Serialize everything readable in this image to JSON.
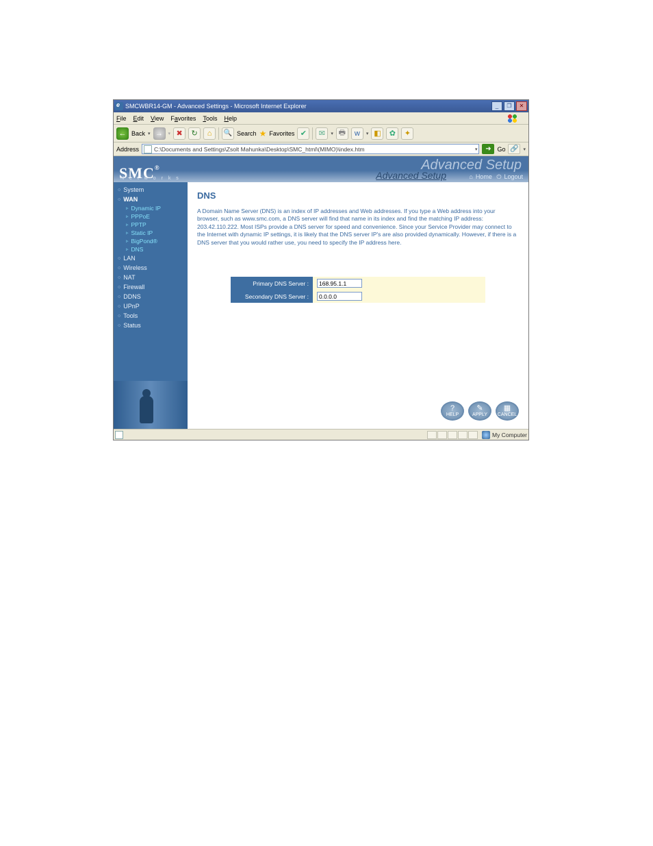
{
  "window": {
    "title": "SMCWBR14-GM - Advanced Settings - Microsoft Internet Explorer"
  },
  "menubar": [
    "File",
    "Edit",
    "View",
    "Favorites",
    "Tools",
    "Help"
  ],
  "toolbar": {
    "back": "Back",
    "search": "Search",
    "favorites": "Favorites"
  },
  "addressbar": {
    "label": "Address",
    "value": "C:\\Documents and Settings\\Zsolt Mahunka\\Desktop\\SMC_html\\(MIMO)\\index.htm",
    "go": "Go"
  },
  "brand": {
    "logo": "SMC",
    "networks": "N e t w o r k s",
    "advanced_big": "Advanced Setup",
    "setup": "Advanced Setup",
    "home": "Home",
    "logout": "Logout"
  },
  "sidebar": {
    "system": "System",
    "wan": "WAN",
    "wan_subs": [
      "Dynamic IP",
      "PPPoE",
      "PPTP",
      "Static IP",
      "BigPond®",
      "DNS"
    ],
    "lan": "LAN",
    "wireless": "Wireless",
    "nat": "NAT",
    "firewall": "Firewall",
    "ddns": "DDNS",
    "upnp": "UPnP",
    "tools": "Tools",
    "status": "Status"
  },
  "content": {
    "heading": "DNS",
    "desc": "A Domain Name Server (DNS) is an index of IP addresses and Web addresses. If you type a Web address into your browser, such as www.smc.com, a DNS server will find that name in its index and find the matching IP address: 203.42.110.222. Most ISPs provide a DNS server for speed and convenience. Since your Service Provider may connect to the Internet with dynamic IP settings, it is likely that the DNS server IP's are also provided dynamically. However, if there is a DNS server that you would rather use, you need to specify the IP address here.",
    "primary_label": "Primary DNS Server :",
    "primary_value": "168.95.1.1",
    "secondary_label": "Secondary DNS Server :",
    "secondary_value": "0.0.0.0"
  },
  "actions": {
    "help": "HELP",
    "apply": "APPLY",
    "cancel": "CANCEL"
  },
  "statusbar": {
    "zone": "My Computer"
  }
}
